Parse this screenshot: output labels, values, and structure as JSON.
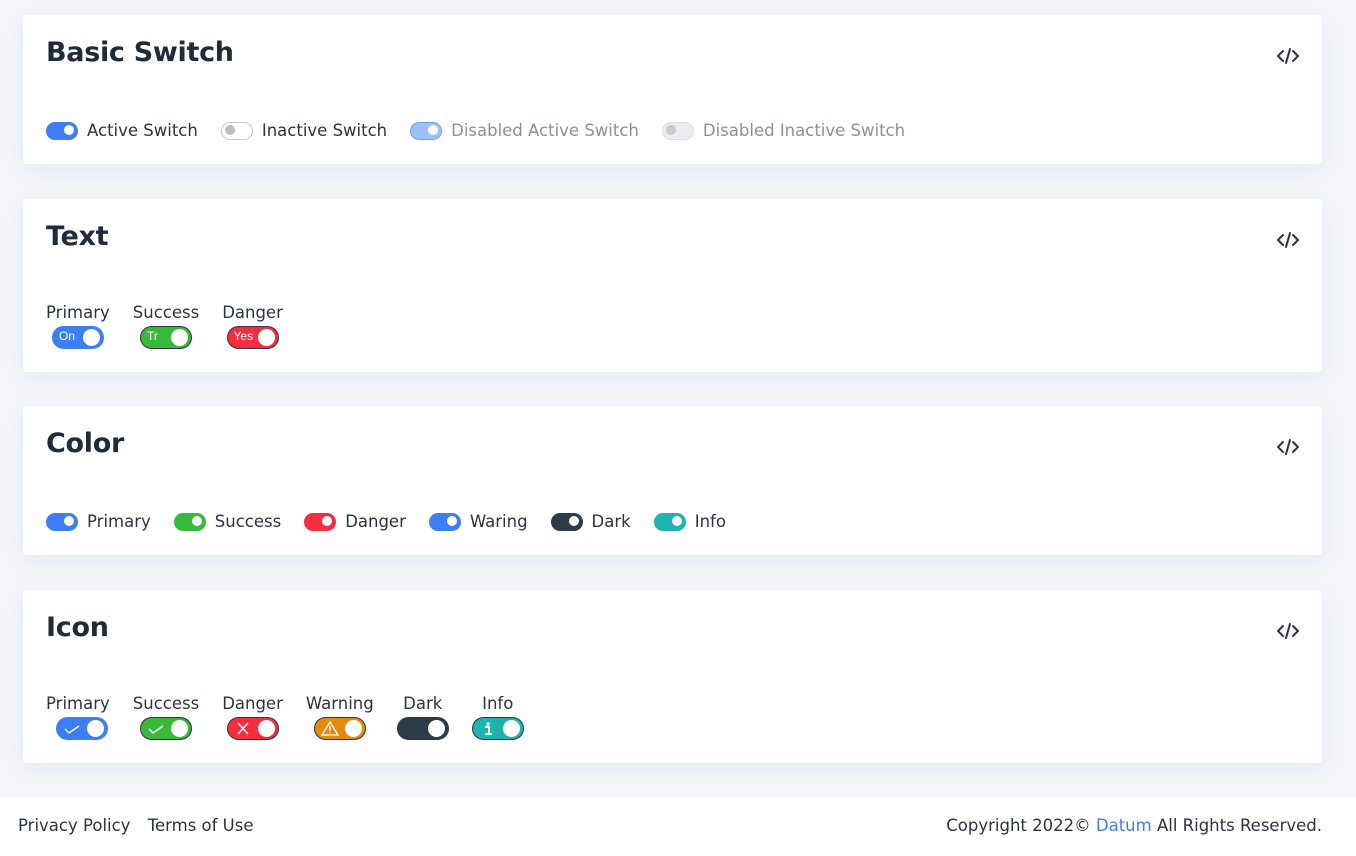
{
  "cards": {
    "basic": {
      "title": "Basic Switch",
      "items": [
        {
          "label": "Active Switch"
        },
        {
          "label": "Inactive Switch"
        },
        {
          "label": "Disabled Active Switch"
        },
        {
          "label": "Disabled Inactive Switch"
        }
      ]
    },
    "text": {
      "title": "Text",
      "items": [
        {
          "label": "Primary",
          "switch_text": "On"
        },
        {
          "label": "Success",
          "switch_text": "Tr"
        },
        {
          "label": "Danger",
          "switch_text": "Yes"
        }
      ]
    },
    "color": {
      "title": "Color",
      "items": [
        {
          "label": "Primary"
        },
        {
          "label": "Success"
        },
        {
          "label": "Danger"
        },
        {
          "label": "Waring"
        },
        {
          "label": "Dark"
        },
        {
          "label": "Info"
        }
      ]
    },
    "icon": {
      "title": "Icon",
      "items": [
        {
          "label": "Primary",
          "icon": "check-icon"
        },
        {
          "label": "Success",
          "icon": "check-icon"
        },
        {
          "label": "Danger",
          "icon": "x-icon"
        },
        {
          "label": "Warning",
          "icon": "warning-icon"
        },
        {
          "label": "Dark",
          "icon": "none"
        },
        {
          "label": "Info",
          "icon": "info-icon"
        }
      ]
    }
  },
  "colors": {
    "primary": "#3d7ef4",
    "success": "#39b93a",
    "danger": "#f42d3f",
    "warning": "#e38a10",
    "dark": "#2f3a4a",
    "info": "#1fb3b0"
  },
  "footer": {
    "privacy": "Privacy Policy",
    "terms": "Terms of Use",
    "copyright_prefix": "Copyright 2022©",
    "brand": "Datum",
    "copyright_suffix": "All Rights Reserved."
  }
}
